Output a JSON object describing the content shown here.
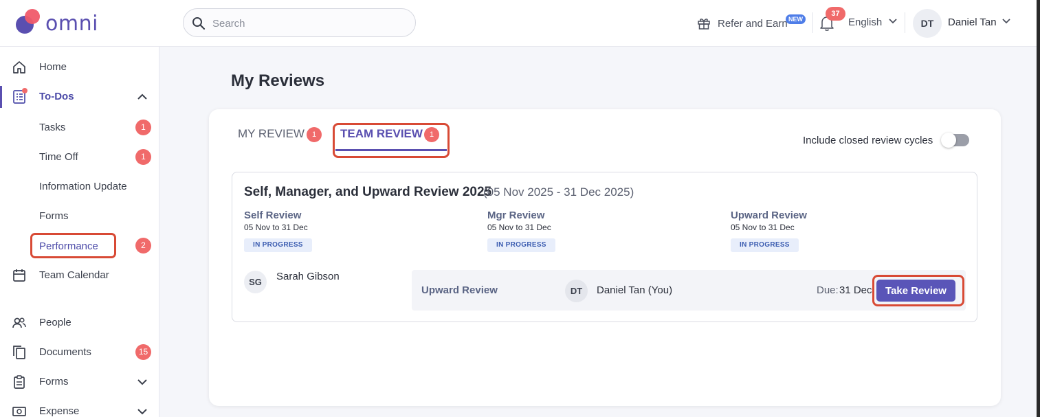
{
  "app": {
    "logo_text": "omni"
  },
  "header": {
    "search_placeholder": "Search",
    "refer_label": "Refer and Earn",
    "refer_badge": "NEW",
    "notification_count": "37",
    "language": "English",
    "user_initials": "DT",
    "user_name": "Daniel Tan"
  },
  "sidebar": {
    "home": "Home",
    "todos": "To-Dos",
    "sub": [
      {
        "label": "Tasks",
        "count": "1"
      },
      {
        "label": "Time Off",
        "count": "1"
      },
      {
        "label": "Information Update",
        "count": ""
      },
      {
        "label": "Forms",
        "count": ""
      },
      {
        "label": "Performance",
        "count": "2"
      }
    ],
    "team_calendar": "Team Calendar",
    "people": "People",
    "documents": "Documents",
    "documents_count": "15",
    "forms": "Forms",
    "expense": "Expense"
  },
  "page": {
    "title": "My Reviews",
    "tabs": [
      {
        "label": "MY REVIEW",
        "count": "1"
      },
      {
        "label": "TEAM REVIEW",
        "count": "1"
      }
    ],
    "closed_toggle_label": "Include closed review cycles",
    "cycle": {
      "title": "Self, Manager, and Upward Review 2025",
      "range": "(05 Nov 2025 - 31 Dec 2025)",
      "types": [
        {
          "name": "Self Review",
          "dates": "05 Nov to 31 Dec",
          "status": "IN PROGRESS"
        },
        {
          "name": "Mgr Review",
          "dates": "05 Nov to 31 Dec",
          "status": "IN PROGRESS"
        },
        {
          "name": "Upward Review",
          "dates": "05 Nov to 31 Dec",
          "status": "IN PROGRESS"
        }
      ],
      "reviewee": {
        "initials": "SG",
        "name": "Sarah Gibson"
      },
      "row": {
        "type": "Upward Review",
        "reviewer_initials": "DT",
        "reviewer_name": "Daniel Tan (You)",
        "due_label": "Due:",
        "due_value": "31 Dec",
        "button": "Take Review"
      }
    }
  },
  "colors": {
    "accent": "#5a4fb0",
    "badge": "#f06a6a",
    "highlight": "#d84a35"
  }
}
